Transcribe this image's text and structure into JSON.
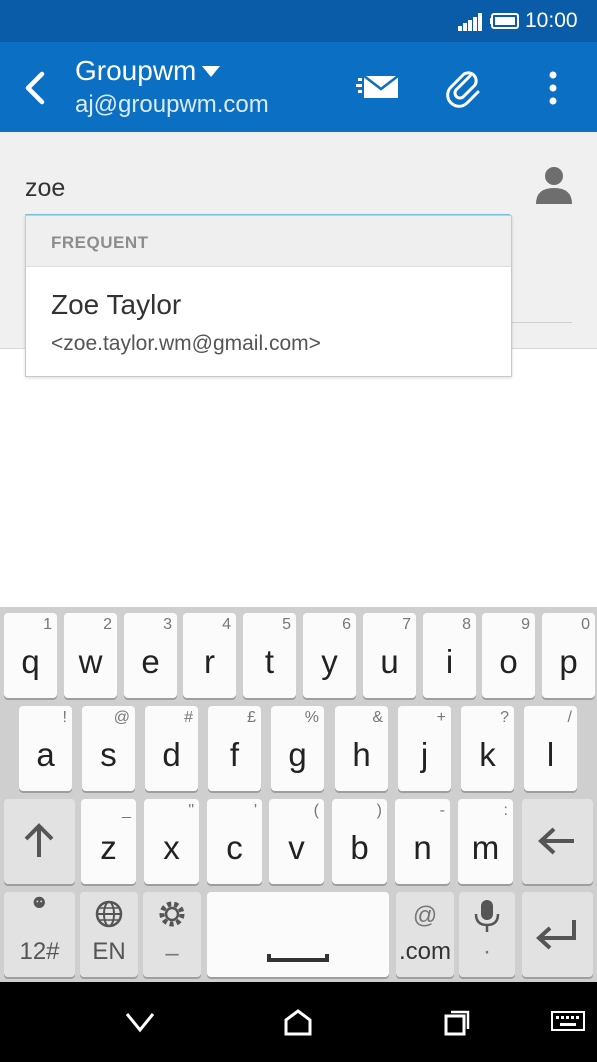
{
  "status_bar": {
    "time": "10:00"
  },
  "app_bar": {
    "account_name": "Groupwm",
    "account_email": "aj@groupwm.com"
  },
  "compose": {
    "to_value": "zoe"
  },
  "suggestions": {
    "header": "FREQUENT",
    "items": [
      {
        "name": "Zoe Taylor",
        "email": "<zoe.taylor.wm@gmail.com>"
      }
    ]
  },
  "keyboard": {
    "row1": [
      {
        "key": "q",
        "hint": "1"
      },
      {
        "key": "w",
        "hint": "2"
      },
      {
        "key": "e",
        "hint": "3"
      },
      {
        "key": "r",
        "hint": "4"
      },
      {
        "key": "t",
        "hint": "5"
      },
      {
        "key": "y",
        "hint": "6"
      },
      {
        "key": "u",
        "hint": "7"
      },
      {
        "key": "i",
        "hint": "8"
      },
      {
        "key": "o",
        "hint": "9"
      },
      {
        "key": "p",
        "hint": "0"
      }
    ],
    "row2": [
      {
        "key": "a",
        "hint": "!"
      },
      {
        "key": "s",
        "hint": "@"
      },
      {
        "key": "d",
        "hint": "#"
      },
      {
        "key": "f",
        "hint": "£"
      },
      {
        "key": "g",
        "hint": "%"
      },
      {
        "key": "h",
        "hint": "&"
      },
      {
        "key": "j",
        "hint": "+"
      },
      {
        "key": "k",
        "hint": "?"
      },
      {
        "key": "l",
        "hint": "/"
      }
    ],
    "row3": [
      {
        "key": "z",
        "hint": "_"
      },
      {
        "key": "x",
        "hint": "\""
      },
      {
        "key": "c",
        "hint": "'"
      },
      {
        "key": "v",
        "hint": "("
      },
      {
        "key": "b",
        "hint": ")"
      },
      {
        "key": "n",
        "hint": "-"
      },
      {
        "key": "m",
        "hint": ":"
      }
    ],
    "symbols_label": "12#",
    "language_label": "EN",
    "settings_hint": "–",
    "at_hint": "@",
    "dotcom_label": ".com",
    "mic_hint": "·"
  }
}
